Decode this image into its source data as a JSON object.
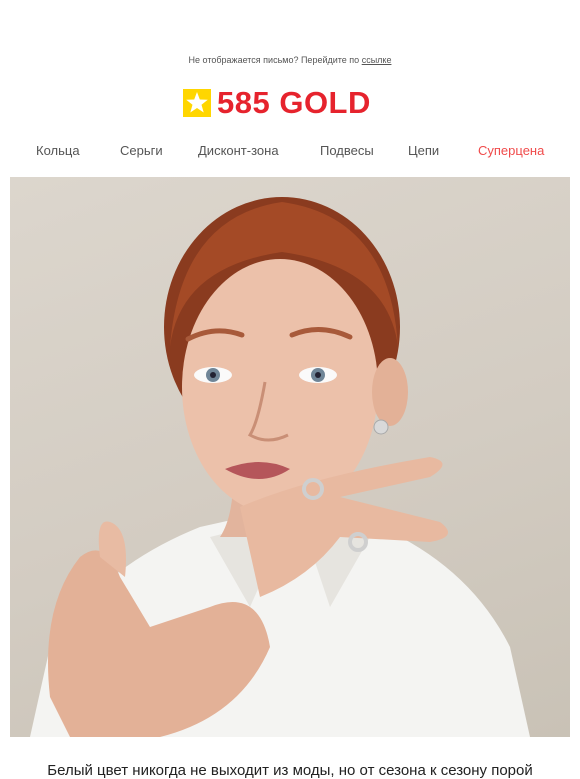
{
  "preheader": {
    "text": "Не отображается письмо? Перейдите по",
    "link": "ссылке"
  },
  "brand": {
    "logo_text": "585 GOLD",
    "logo_color": "#e6232d",
    "mark_color": "#ffd600"
  },
  "nav": {
    "items": [
      {
        "label": "Кольца"
      },
      {
        "label": "Серьги"
      },
      {
        "label": "Дисконт-зона"
      },
      {
        "label": "Подвесы"
      },
      {
        "label": "Цепи"
      },
      {
        "label": "Суперцена",
        "color": "#f04b4b"
      }
    ]
  },
  "hero": {
    "image_icon": "model-portrait-image"
  },
  "intro": {
    "text": "Белый цвет никогда не выходит из моды, но от сезона к сезону порой"
  }
}
